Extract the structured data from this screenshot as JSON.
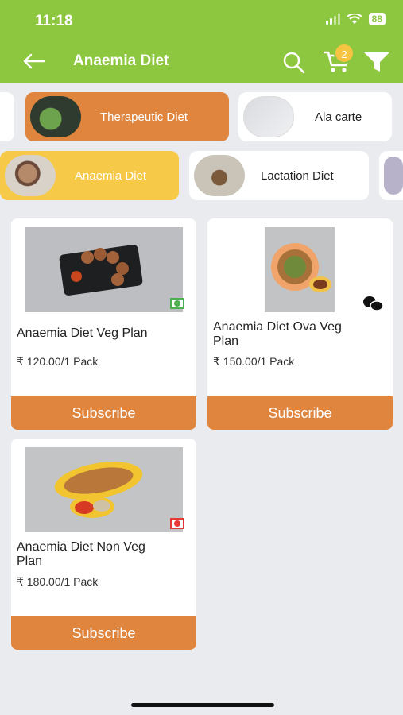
{
  "status": {
    "time": "11:18",
    "battery": "88"
  },
  "nav": {
    "title": "Anaemia Diet",
    "cart_count": "2"
  },
  "categories": [
    {
      "label": "Therapeutic Diet",
      "selected": true
    },
    {
      "label": "Ala carte",
      "selected": false
    }
  ],
  "subcategories": [
    {
      "label": "Anaemia Diet",
      "selected": true
    },
    {
      "label": "Lactation Diet",
      "selected": false
    }
  ],
  "products": [
    {
      "name": "Anaemia Diet  Veg Plan",
      "price": "₹ 120.00/1 Pack",
      "diet_type": "veg",
      "button": "Subscribe"
    },
    {
      "name": "Anaemia Diet  Ova Veg Plan",
      "price": "₹ 150.00/1 Pack",
      "diet_type": "egg",
      "button": "Subscribe"
    },
    {
      "name": "Anaemia Diet  Non Veg Plan",
      "price": "₹ 180.00/1 Pack",
      "diet_type": "non-veg",
      "button": "Subscribe"
    }
  ],
  "colors": {
    "header": "#8dc63f",
    "category_selected": "#e0853e",
    "subcategory_selected": "#f7c948",
    "subscribe": "#e0853e",
    "veg": "#4caf50",
    "non_veg": "#e53935"
  }
}
